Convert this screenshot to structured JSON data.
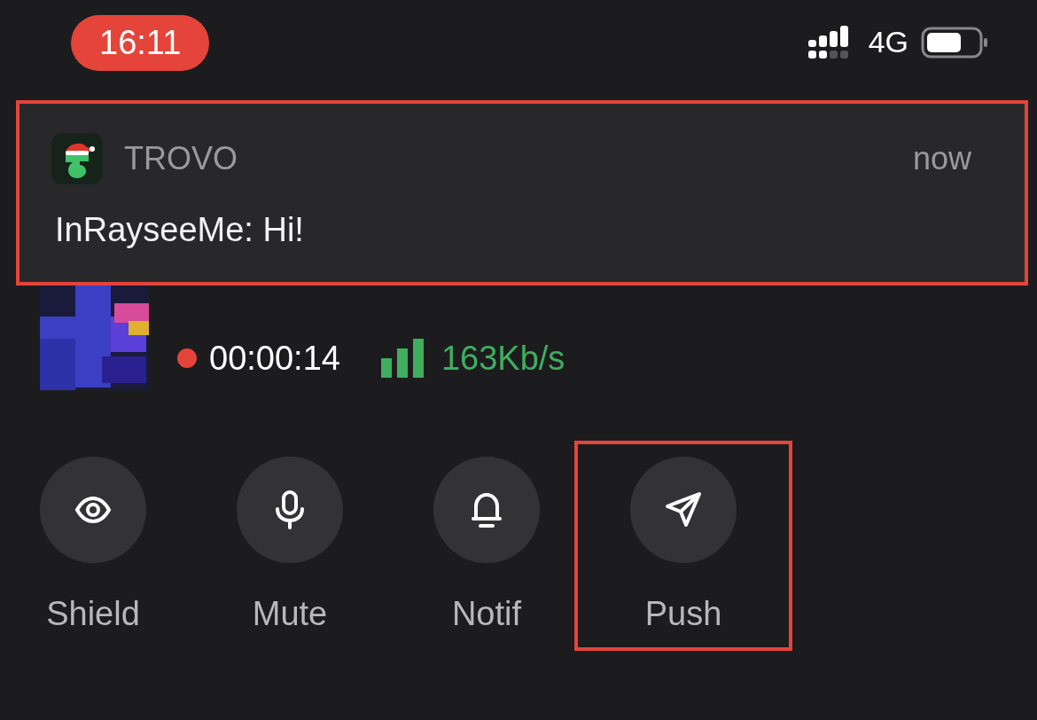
{
  "status_bar": {
    "time": "16:11",
    "network": "4G"
  },
  "notification": {
    "app": "TROVO",
    "time": "now",
    "message": "InRayseeMe: Hi!",
    "highlighted": true
  },
  "stream": {
    "recording": true,
    "duration": "00:00:14",
    "bitrate": "163Kb/s"
  },
  "actions": [
    {
      "label": "Shield",
      "highlighted": false
    },
    {
      "label": "Mute",
      "highlighted": false
    },
    {
      "label": "Notif",
      "highlighted": false
    },
    {
      "label": "Push",
      "highlighted": true
    }
  ]
}
